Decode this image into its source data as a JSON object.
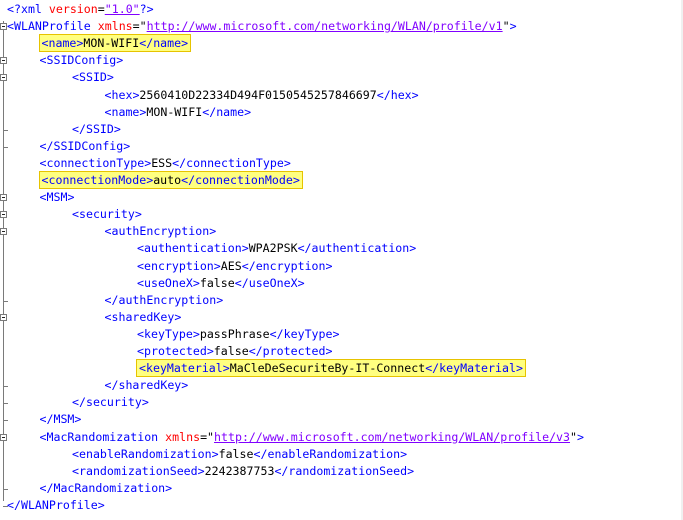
{
  "lines": [
    {
      "indent": 0,
      "parts": [
        [
          "pi",
          "<?"
        ],
        [
          "tag",
          "xml "
        ],
        [
          "attr",
          "version"
        ],
        [
          "punct",
          "="
        ],
        [
          "url",
          "\"1.0\""
        ],
        [
          "pi",
          "?>"
        ]
      ]
    },
    {
      "indent": 0,
      "parts": [
        [
          "bracket",
          "<"
        ],
        [
          "tag",
          "WLANProfile "
        ],
        [
          "attr",
          "xmlns"
        ],
        [
          "punct",
          "=\""
        ],
        [
          "url",
          "http://www.microsoft.com/networking/WLAN/profile/v1"
        ],
        [
          "punct",
          "\""
        ],
        [
          "bracket",
          ">"
        ]
      ]
    },
    {
      "indent": 1,
      "highlight": true,
      "parts": [
        [
          "bracket",
          "<"
        ],
        [
          "tag",
          "name"
        ],
        [
          "bracket",
          ">"
        ],
        [
          "text",
          "MON-WIFI"
        ],
        [
          "bracket",
          "</"
        ],
        [
          "tag",
          "name"
        ],
        [
          "bracket",
          ">"
        ]
      ]
    },
    {
      "indent": 1,
      "parts": [
        [
          "bracket",
          "<"
        ],
        [
          "tag",
          "SSIDConfig"
        ],
        [
          "bracket",
          ">"
        ]
      ]
    },
    {
      "indent": 2,
      "parts": [
        [
          "bracket",
          "<"
        ],
        [
          "tag",
          "SSID"
        ],
        [
          "bracket",
          ">"
        ]
      ]
    },
    {
      "indent": 3,
      "parts": [
        [
          "bracket",
          "<"
        ],
        [
          "tag",
          "hex"
        ],
        [
          "bracket",
          ">"
        ],
        [
          "text",
          "2560410D22334D494F0150545257846697"
        ],
        [
          "bracket",
          "</"
        ],
        [
          "tag",
          "hex"
        ],
        [
          "bracket",
          ">"
        ]
      ]
    },
    {
      "indent": 3,
      "parts": [
        [
          "bracket",
          "<"
        ],
        [
          "tag",
          "name"
        ],
        [
          "bracket",
          ">"
        ],
        [
          "text",
          "MON-WIFI"
        ],
        [
          "bracket",
          "</"
        ],
        [
          "tag",
          "name"
        ],
        [
          "bracket",
          ">"
        ]
      ]
    },
    {
      "indent": 2,
      "parts": [
        [
          "bracket",
          "</"
        ],
        [
          "tag",
          "SSID"
        ],
        [
          "bracket",
          ">"
        ]
      ]
    },
    {
      "indent": 1,
      "parts": [
        [
          "bracket",
          "</"
        ],
        [
          "tag",
          "SSIDConfig"
        ],
        [
          "bracket",
          ">"
        ]
      ]
    },
    {
      "indent": 1,
      "parts": [
        [
          "bracket",
          "<"
        ],
        [
          "tag",
          "connectionType"
        ],
        [
          "bracket",
          ">"
        ],
        [
          "text",
          "ESS"
        ],
        [
          "bracket",
          "</"
        ],
        [
          "tag",
          "connectionType"
        ],
        [
          "bracket",
          ">"
        ]
      ]
    },
    {
      "indent": 1,
      "highlight": true,
      "parts": [
        [
          "bracket",
          "<"
        ],
        [
          "tag",
          "connectionMode"
        ],
        [
          "bracket",
          ">"
        ],
        [
          "text",
          "auto"
        ],
        [
          "bracket",
          "</"
        ],
        [
          "tag",
          "connectionMode"
        ],
        [
          "bracket",
          ">"
        ]
      ]
    },
    {
      "indent": 1,
      "parts": [
        [
          "bracket",
          "<"
        ],
        [
          "tag",
          "MSM"
        ],
        [
          "bracket",
          ">"
        ]
      ]
    },
    {
      "indent": 2,
      "parts": [
        [
          "bracket",
          "<"
        ],
        [
          "tag",
          "security"
        ],
        [
          "bracket",
          ">"
        ]
      ]
    },
    {
      "indent": 3,
      "parts": [
        [
          "bracket",
          "<"
        ],
        [
          "tag",
          "authEncryption"
        ],
        [
          "bracket",
          ">"
        ]
      ]
    },
    {
      "indent": 4,
      "parts": [
        [
          "bracket",
          "<"
        ],
        [
          "tag",
          "authentication"
        ],
        [
          "bracket",
          ">"
        ],
        [
          "text",
          "WPA2PSK"
        ],
        [
          "bracket",
          "</"
        ],
        [
          "tag",
          "authentication"
        ],
        [
          "bracket",
          ">"
        ]
      ]
    },
    {
      "indent": 4,
      "parts": [
        [
          "bracket",
          "<"
        ],
        [
          "tag",
          "encryption"
        ],
        [
          "bracket",
          ">"
        ],
        [
          "text",
          "AES"
        ],
        [
          "bracket",
          "</"
        ],
        [
          "tag",
          "encryption"
        ],
        [
          "bracket",
          ">"
        ]
      ]
    },
    {
      "indent": 4,
      "parts": [
        [
          "bracket",
          "<"
        ],
        [
          "tag",
          "useOneX"
        ],
        [
          "bracket",
          ">"
        ],
        [
          "text",
          "false"
        ],
        [
          "bracket",
          "</"
        ],
        [
          "tag",
          "useOneX"
        ],
        [
          "bracket",
          ">"
        ]
      ]
    },
    {
      "indent": 3,
      "parts": [
        [
          "bracket",
          "</"
        ],
        [
          "tag",
          "authEncryption"
        ],
        [
          "bracket",
          ">"
        ]
      ]
    },
    {
      "indent": 3,
      "parts": [
        [
          "bracket",
          "<"
        ],
        [
          "tag",
          "sharedKey"
        ],
        [
          "bracket",
          ">"
        ]
      ]
    },
    {
      "indent": 4,
      "parts": [
        [
          "bracket",
          "<"
        ],
        [
          "tag",
          "keyType"
        ],
        [
          "bracket",
          ">"
        ],
        [
          "text",
          "passPhrase"
        ],
        [
          "bracket",
          "</"
        ],
        [
          "tag",
          "keyType"
        ],
        [
          "bracket",
          ">"
        ]
      ]
    },
    {
      "indent": 4,
      "parts": [
        [
          "bracket",
          "<"
        ],
        [
          "tag",
          "protected"
        ],
        [
          "bracket",
          ">"
        ],
        [
          "text",
          "false"
        ],
        [
          "bracket",
          "</"
        ],
        [
          "tag",
          "protected"
        ],
        [
          "bracket",
          ">"
        ]
      ]
    },
    {
      "indent": 4,
      "highlight": true,
      "parts": [
        [
          "bracket",
          "<"
        ],
        [
          "tag",
          "keyMaterial"
        ],
        [
          "bracket",
          ">"
        ],
        [
          "text",
          "MaCleDeSecuriteBy-IT-Connect"
        ],
        [
          "bracket",
          "</"
        ],
        [
          "tag",
          "keyMaterial"
        ],
        [
          "bracket",
          ">"
        ]
      ]
    },
    {
      "indent": 3,
      "parts": [
        [
          "bracket",
          "</"
        ],
        [
          "tag",
          "sharedKey"
        ],
        [
          "bracket",
          ">"
        ]
      ]
    },
    {
      "indent": 2,
      "parts": [
        [
          "bracket",
          "</"
        ],
        [
          "tag",
          "security"
        ],
        [
          "bracket",
          ">"
        ]
      ]
    },
    {
      "indent": 1,
      "parts": [
        [
          "bracket",
          "</"
        ],
        [
          "tag",
          "MSM"
        ],
        [
          "bracket",
          ">"
        ]
      ]
    },
    {
      "indent": 1,
      "parts": [
        [
          "bracket",
          "<"
        ],
        [
          "tag",
          "MacRandomization "
        ],
        [
          "attr",
          "xmlns"
        ],
        [
          "punct",
          "=\""
        ],
        [
          "url",
          "http://www.microsoft.com/networking/WLAN/profile/v3"
        ],
        [
          "punct",
          "\""
        ],
        [
          "bracket",
          ">"
        ]
      ]
    },
    {
      "indent": 2,
      "parts": [
        [
          "bracket",
          "<"
        ],
        [
          "tag",
          "enableRandomization"
        ],
        [
          "bracket",
          ">"
        ],
        [
          "text",
          "false"
        ],
        [
          "bracket",
          "</"
        ],
        [
          "tag",
          "enableRandomization"
        ],
        [
          "bracket",
          ">"
        ]
      ]
    },
    {
      "indent": 2,
      "parts": [
        [
          "bracket",
          "<"
        ],
        [
          "tag",
          "randomizationSeed"
        ],
        [
          "bracket",
          ">"
        ],
        [
          "text",
          "2242387753"
        ],
        [
          "bracket",
          "</"
        ],
        [
          "tag",
          "randomizationSeed"
        ],
        [
          "bracket",
          ">"
        ]
      ]
    },
    {
      "indent": 1,
      "parts": [
        [
          "bracket",
          "</"
        ],
        [
          "tag",
          "MacRandomization"
        ],
        [
          "bracket",
          ">"
        ]
      ]
    },
    {
      "indent": 0,
      "parts": [
        [
          "bracket",
          "</"
        ],
        [
          "tag",
          "WLANProfile"
        ],
        [
          "bracket",
          ">"
        ]
      ]
    }
  ],
  "colors": {
    "tag": "#0000ff",
    "attribute": "#ff0000",
    "url": "#8000ff",
    "text": "#000000",
    "highlight_fill": "#ffff80",
    "highlight_border": "#e6c300"
  },
  "folds": [
    1,
    3,
    4,
    11,
    12,
    13,
    18,
    25
  ]
}
